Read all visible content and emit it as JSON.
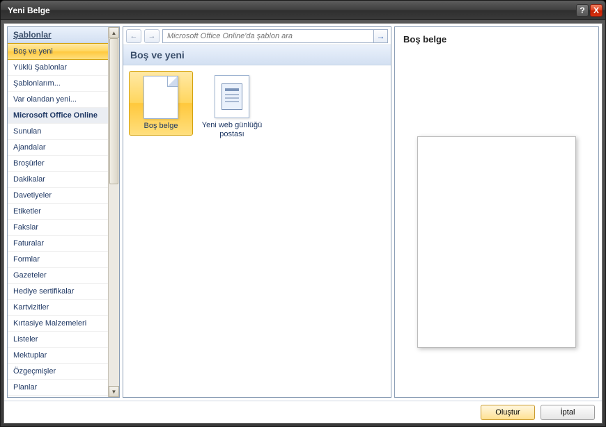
{
  "window": {
    "title": "Yeni Belge"
  },
  "sidebar": {
    "header": "Şablonlar",
    "items": [
      {
        "label": "Boş ve yeni",
        "selected": true
      },
      {
        "label": "Yüklü Şablonlar"
      },
      {
        "label": "Şablonlarım..."
      },
      {
        "label": "Var olandan yeni..."
      },
      {
        "label": "Microsoft Office Online",
        "section": true
      },
      {
        "label": "Sunulan"
      },
      {
        "label": "Ajandalar"
      },
      {
        "label": "Broşürler"
      },
      {
        "label": "Dakikalar"
      },
      {
        "label": "Davetiyeler"
      },
      {
        "label": "Etiketler"
      },
      {
        "label": "Fakslar"
      },
      {
        "label": "Faturalar"
      },
      {
        "label": "Formlar"
      },
      {
        "label": "Gazeteler"
      },
      {
        "label": "Hediye sertifikalar"
      },
      {
        "label": "Kartvizitler"
      },
      {
        "label": "Kırtasiye Malzemeleri"
      },
      {
        "label": "Listeler"
      },
      {
        "label": "Mektuplar"
      },
      {
        "label": "Özgeçmişler"
      },
      {
        "label": "Planlar"
      }
    ]
  },
  "toolbar": {
    "search_placeholder": "Microsoft Office Online'da şablon ara"
  },
  "middle": {
    "section_title": "Boş ve yeni",
    "templates": [
      {
        "label": "Boş belge",
        "kind": "doc",
        "selected": true
      },
      {
        "label": "Yeni web günlüğü postası",
        "kind": "blog"
      }
    ]
  },
  "preview": {
    "title": "Boş belge"
  },
  "buttons": {
    "create": "Oluştur",
    "cancel": "İptal"
  },
  "icons": {
    "back": "←",
    "forward": "→",
    "go": "→",
    "help": "?",
    "close": "X",
    "up": "▲",
    "down": "▼"
  }
}
